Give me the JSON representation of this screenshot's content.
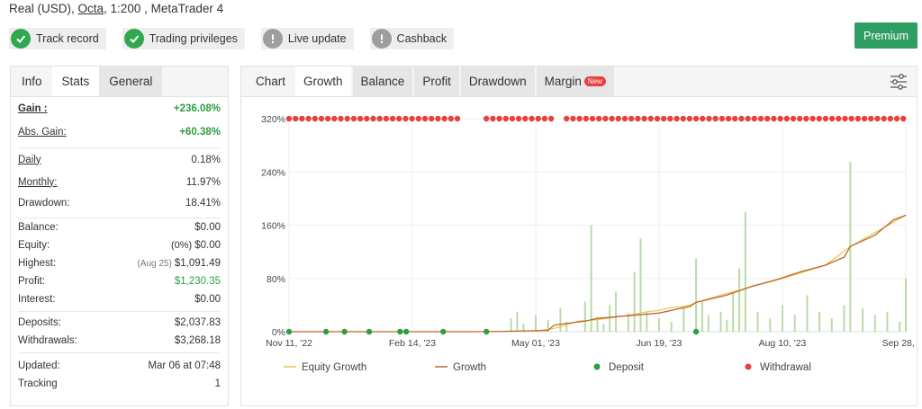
{
  "header": {
    "account_prefix": "Real (USD),",
    "broker": "Octa",
    "account_suffix": ", 1:200 , MetaTrader 4"
  },
  "badges": [
    {
      "label": "Track record",
      "icon": "check-icon",
      "status": "ok"
    },
    {
      "label": "Trading privileges",
      "icon": "check-icon",
      "status": "ok"
    },
    {
      "label": "Live update",
      "icon": "exclamation-icon",
      "status": "warn"
    },
    {
      "label": "Cashback",
      "icon": "exclamation-icon",
      "status": "warn"
    }
  ],
  "premium_label": "Premium",
  "left_tabs": [
    "Info",
    "Stats",
    "General"
  ],
  "stats": {
    "gain": {
      "label": "Gain :",
      "value": "+236.08%"
    },
    "abs_gain": {
      "label": "Abs. Gain:",
      "value": "+60.38%"
    },
    "daily": {
      "label": "Daily",
      "value": "0.18%"
    },
    "monthly": {
      "label": "Monthly:",
      "value": "11.97%"
    },
    "drawdown": {
      "label": "Drawdown:",
      "value": "18.41%"
    },
    "balance": {
      "label": "Balance:",
      "value": "$0.00"
    },
    "equity": {
      "label": "Equity:",
      "prefix": "(0%)",
      "value": "$0.00"
    },
    "highest": {
      "label": "Highest:",
      "prefix": "(Aug 25)",
      "value": "$1,091.49"
    },
    "profit": {
      "label": "Profit:",
      "value": "$1,230.35"
    },
    "interest": {
      "label": "Interest:",
      "value": "$0.00"
    },
    "deposits": {
      "label": "Deposits:",
      "value": "$2,037.83"
    },
    "withdrawals": {
      "label": "Withdrawals:",
      "value": "$3,268.18"
    },
    "updated": {
      "label": "Updated:",
      "value": "Mar 06 at 07:48"
    },
    "tracking": {
      "label": "Tracking",
      "value": "1"
    }
  },
  "chart_tabs": [
    {
      "label": "Chart"
    },
    {
      "label": "Growth"
    },
    {
      "label": "Balance"
    },
    {
      "label": "Profit"
    },
    {
      "label": "Drawdown"
    },
    {
      "label": "Margin",
      "badge": "New"
    }
  ],
  "chart_data": {
    "type": "line",
    "x_ticks": [
      "Nov 11, '22",
      "Feb 14, '23",
      "May 01, '23",
      "Jun 19, '23",
      "Aug 10, '23",
      "Sep 28, '23"
    ],
    "y_ticks": [
      "0%",
      "80%",
      "160%",
      "240%",
      "320%"
    ],
    "ylim": [
      0,
      320
    ],
    "colors": {
      "equity": "#e8c34a",
      "growth": "#c0652f",
      "deposit": "#2e9e3e",
      "withdrawal": "#e8403d",
      "volume": "#b9dba5"
    },
    "legend": [
      {
        "label": "Equity Growth",
        "kind": "line",
        "color": "#e8c34a"
      },
      {
        "label": "Growth",
        "kind": "line",
        "color": "#c0652f"
      },
      {
        "label": "Deposit",
        "kind": "dot",
        "color": "#2e9e3e"
      },
      {
        "label": "Withdrawal",
        "kind": "dot",
        "color": "#e8403d"
      }
    ],
    "growth": [
      [
        0,
        0
      ],
      [
        0.15,
        0
      ],
      [
        0.3,
        0
      ],
      [
        0.35,
        0.5
      ],
      [
        0.42,
        2
      ],
      [
        0.43,
        10
      ],
      [
        0.48,
        16
      ],
      [
        0.5,
        20
      ],
      [
        0.55,
        24
      ],
      [
        0.6,
        28
      ],
      [
        0.63,
        34
      ],
      [
        0.65,
        38
      ],
      [
        0.66,
        44
      ],
      [
        0.71,
        55
      ],
      [
        0.75,
        68
      ],
      [
        0.79,
        78
      ],
      [
        0.83,
        90
      ],
      [
        0.87,
        100
      ],
      [
        0.9,
        112
      ],
      [
        0.91,
        128
      ],
      [
        0.95,
        145
      ],
      [
        0.98,
        168
      ],
      [
        1.0,
        175
      ]
    ],
    "equity": [
      [
        0.4,
        1
      ],
      [
        0.43,
        5
      ],
      [
        0.47,
        16
      ],
      [
        0.5,
        18
      ],
      [
        0.56,
        26
      ],
      [
        0.58,
        30
      ],
      [
        0.6,
        32
      ],
      [
        0.62,
        36
      ],
      [
        0.64,
        38
      ],
      [
        0.65,
        40
      ],
      [
        0.66,
        44
      ],
      [
        0.7,
        55
      ],
      [
        0.76,
        70
      ],
      [
        0.8,
        80
      ],
      [
        0.87,
        100
      ],
      [
        0.91,
        128
      ],
      [
        1.0,
        175
      ]
    ],
    "bars": [
      [
        0.36,
        20
      ],
      [
        0.37,
        30
      ],
      [
        0.38,
        12
      ],
      [
        0.4,
        25
      ],
      [
        0.42,
        18
      ],
      [
        0.44,
        35
      ],
      [
        0.45,
        15
      ],
      [
        0.48,
        45
      ],
      [
        0.49,
        160
      ],
      [
        0.5,
        22
      ],
      [
        0.51,
        12
      ],
      [
        0.52,
        40
      ],
      [
        0.53,
        60
      ],
      [
        0.55,
        28
      ],
      [
        0.56,
        90
      ],
      [
        0.57,
        140
      ],
      [
        0.58,
        30
      ],
      [
        0.6,
        20
      ],
      [
        0.62,
        15
      ],
      [
        0.64,
        35
      ],
      [
        0.66,
        110
      ],
      [
        0.67,
        45
      ],
      [
        0.68,
        25
      ],
      [
        0.7,
        30
      ],
      [
        0.71,
        18
      ],
      [
        0.72,
        60
      ],
      [
        0.73,
        95
      ],
      [
        0.74,
        180
      ],
      [
        0.76,
        30
      ],
      [
        0.78,
        20
      ],
      [
        0.8,
        40
      ],
      [
        0.82,
        25
      ],
      [
        0.84,
        55
      ],
      [
        0.86,
        30
      ],
      [
        0.88,
        20
      ],
      [
        0.9,
        40
      ],
      [
        0.91,
        255
      ],
      [
        0.93,
        35
      ],
      [
        0.95,
        25
      ],
      [
        0.97,
        30
      ],
      [
        0.99,
        15
      ],
      [
        1.0,
        80
      ]
    ],
    "deposits": [
      0.0,
      0.06,
      0.09,
      0.13,
      0.18,
      0.19,
      0.25,
      0.32,
      0.66
    ],
    "withdrawals_dense": [
      [
        0.0,
        0.28
      ],
      [
        0.32,
        0.43
      ],
      [
        0.45,
        1.0
      ]
    ]
  }
}
